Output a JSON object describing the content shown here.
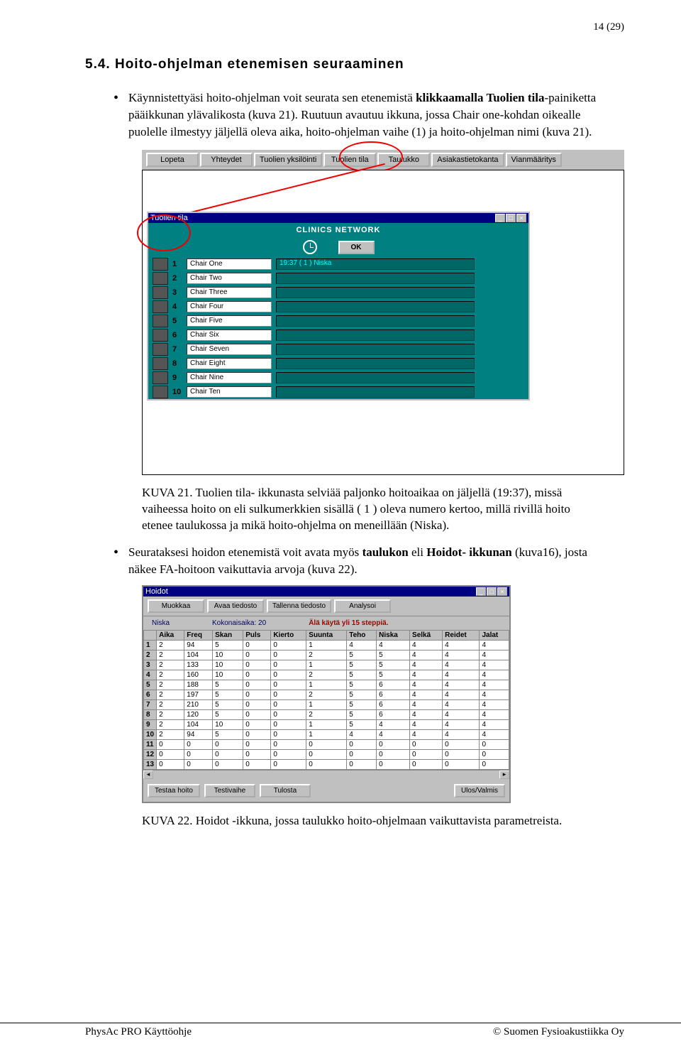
{
  "page_num": "14 (29)",
  "heading": "5.4. Hoito-ohjelman etenemisen seuraaminen",
  "bullets": {
    "b1_prefix": "Käynnistettyäsi hoito-ohjelman voit seurata sen etenemistä ",
    "b1_bold1": "klikkaamalla Tuolien tila",
    "b1_mid": "-painiketta pääikkunan ylävalikosta (kuva 21). Ruutuun avautuu ikkuna, jossa Chair one-kohdan oikealle puolelle ilmestyy jäljellä oleva aika, hoito-ohjelman vaihe (1) ja hoito-ohjelman nimi (kuva 21).",
    "b2_prefix": "Seurataksesi hoidon etenemistä voit avata myös ",
    "b2_bold1": "taulukon",
    "b2_mid1": " eli ",
    "b2_bold2": "Hoidot- ikkunan",
    "b2_suffix": " (kuva16), josta näkee FA-hoitoon vaikuttavia arvoja (kuva 22)."
  },
  "fig21": {
    "toolbar": [
      "Lopeta",
      "Yhteydet",
      "Tuolien yksilöinti",
      "Tuolien tila",
      "Taulukko",
      "Asiakastietokanta",
      "Vianmääritys"
    ],
    "window_title": "Tuolien tila",
    "subtitle": "CLINICS NETWORK",
    "ok": "OK",
    "chairs": [
      "Chair One",
      "Chair Two",
      "Chair Three",
      "Chair Four",
      "Chair Five",
      "Chair Six",
      "Chair Seven",
      "Chair Eight",
      "Chair Nine",
      "Chair Ten"
    ],
    "slot1": "19:37   ( 1 )   Niska",
    "caption": "KUVA 21. Tuolien tila- ikkunasta selviää paljonko hoitoaikaa on jäljellä (19:37), missä vaiheessa hoito on eli sulkumerkkien sisällä ( 1 ) oleva numero kertoo, millä rivillä hoito etenee taulukossa ja mikä hoito-ohjelma on meneillään (Niska)."
  },
  "fig22": {
    "title": "Hoidot",
    "menus": [
      "Muokkaa",
      "Avaa tiedosto",
      "Tallenna tiedosto",
      "Analysoi"
    ],
    "status": {
      "niska": "Niska",
      "kok": "Kokonaisaika: 20",
      "warn": "Älä käytä yli 15 steppiä."
    },
    "headers": [
      "",
      "Aika",
      "Freq",
      "Skan",
      "Puls",
      "Kierto",
      "Suunta",
      "Teho",
      "Niska",
      "Selkä",
      "Reidet",
      "Jalat"
    ],
    "rows": [
      [
        "1",
        "2",
        "94",
        "5",
        "0",
        "0",
        "1",
        "4",
        "4",
        "4",
        "4",
        "4"
      ],
      [
        "2",
        "2",
        "104",
        "10",
        "0",
        "0",
        "2",
        "5",
        "5",
        "4",
        "4",
        "4"
      ],
      [
        "3",
        "2",
        "133",
        "10",
        "0",
        "0",
        "1",
        "5",
        "5",
        "4",
        "4",
        "4"
      ],
      [
        "4",
        "2",
        "160",
        "10",
        "0",
        "0",
        "2",
        "5",
        "5",
        "4",
        "4",
        "4"
      ],
      [
        "5",
        "2",
        "188",
        "5",
        "0",
        "0",
        "1",
        "5",
        "6",
        "4",
        "4",
        "4"
      ],
      [
        "6",
        "2",
        "197",
        "5",
        "0",
        "0",
        "2",
        "5",
        "6",
        "4",
        "4",
        "4"
      ],
      [
        "7",
        "2",
        "210",
        "5",
        "0",
        "0",
        "1",
        "5",
        "6",
        "4",
        "4",
        "4"
      ],
      [
        "8",
        "2",
        "120",
        "5",
        "0",
        "0",
        "2",
        "5",
        "6",
        "4",
        "4",
        "4"
      ],
      [
        "9",
        "2",
        "104",
        "10",
        "0",
        "0",
        "1",
        "5",
        "4",
        "4",
        "4",
        "4"
      ],
      [
        "10",
        "2",
        "94",
        "5",
        "0",
        "0",
        "1",
        "4",
        "4",
        "4",
        "4",
        "4"
      ],
      [
        "11",
        "0",
        "0",
        "0",
        "0",
        "0",
        "0",
        "0",
        "0",
        "0",
        "0",
        "0"
      ],
      [
        "12",
        "0",
        "0",
        "0",
        "0",
        "0",
        "0",
        "0",
        "0",
        "0",
        "0",
        "0"
      ],
      [
        "13",
        "0",
        "0",
        "0",
        "0",
        "0",
        "0",
        "0",
        "0",
        "0",
        "0",
        "0"
      ]
    ],
    "footer_left": [
      "Testaa hoito",
      "Testivaihe",
      "Tulosta"
    ],
    "footer_right": "Ulos/Valmis",
    "caption": "KUVA 22. Hoidot -ikkuna, jossa taulukko hoito-ohjelmaan vaikuttavista parametreista."
  },
  "footer": {
    "left": "PhysAc PRO Käyttöohje",
    "right": "© Suomen Fysioakustiikka Oy"
  }
}
